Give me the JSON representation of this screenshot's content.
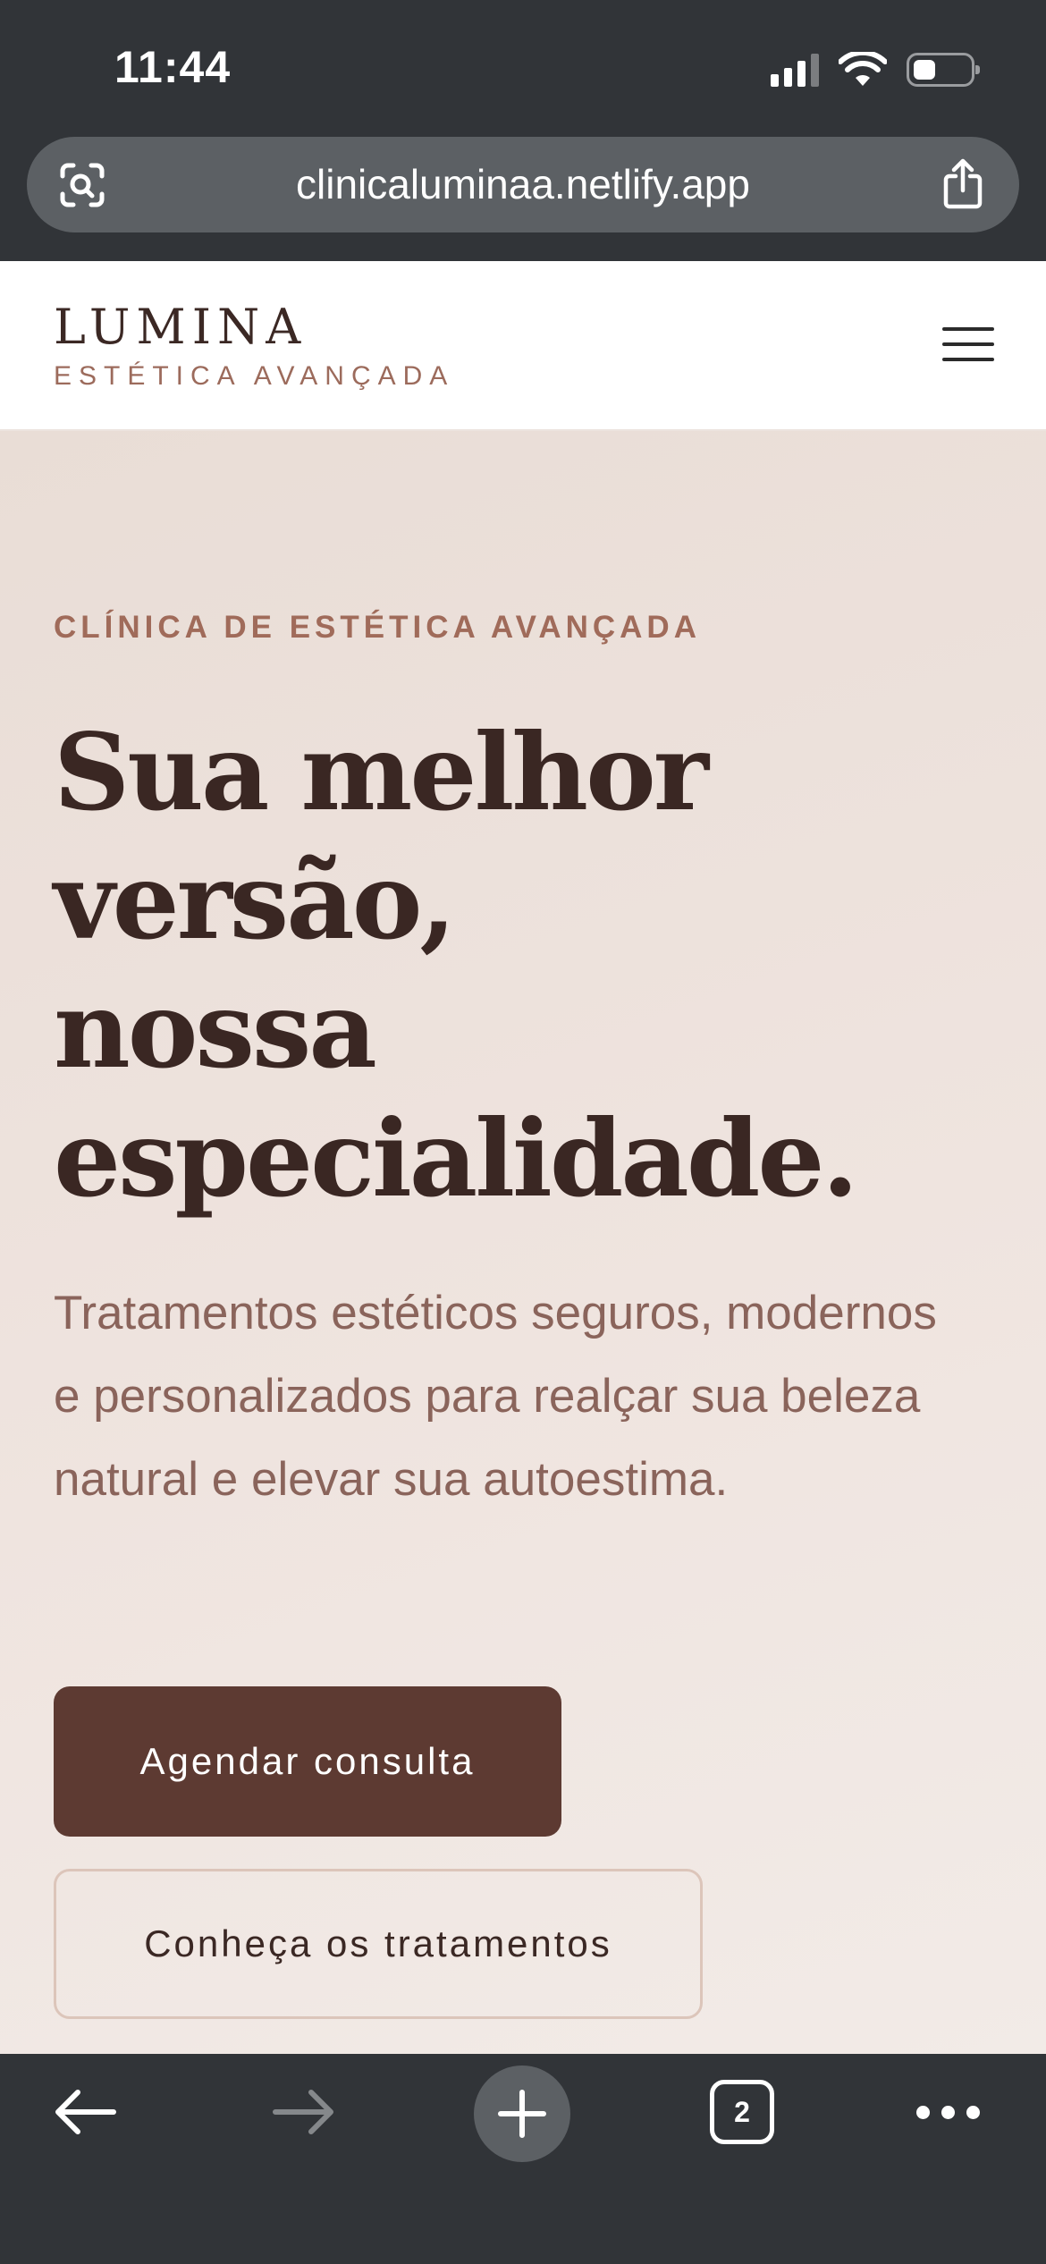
{
  "status_bar": {
    "time": "11:44"
  },
  "browser": {
    "url": "clinicaluminaa.netlify.app",
    "tab_count": "2"
  },
  "site": {
    "logo_title": "LUMINA",
    "logo_subtitle": "ESTÉTICA AVANÇADA"
  },
  "hero": {
    "eyebrow": "CLÍNICA DE ESTÉTICA AVANÇADA",
    "title_lines": [
      "Sua melhor",
      "versão,",
      "nossa",
      "especialidade."
    ],
    "description": "Tratamentos estéticos seguros, modernos e personalizados para realçar sua beleza natural e elevar sua autoestima.",
    "primary_cta": "Agendar consulta",
    "secondary_cta": "Conheça os tratamentos"
  },
  "colors": {
    "browser_chrome": "#313438",
    "brand_dark": "#5d3a32",
    "accent": "#a06b5a",
    "hero_background": "#ede3dd"
  },
  "icons": {
    "url_left": "visual-search-icon",
    "url_right": "share-icon",
    "header_right": "hamburger-menu-icon",
    "toolbar": [
      "back-arrow-icon",
      "forward-arrow-icon",
      "plus-icon",
      "tabs-icon",
      "more-dots-icon"
    ]
  }
}
